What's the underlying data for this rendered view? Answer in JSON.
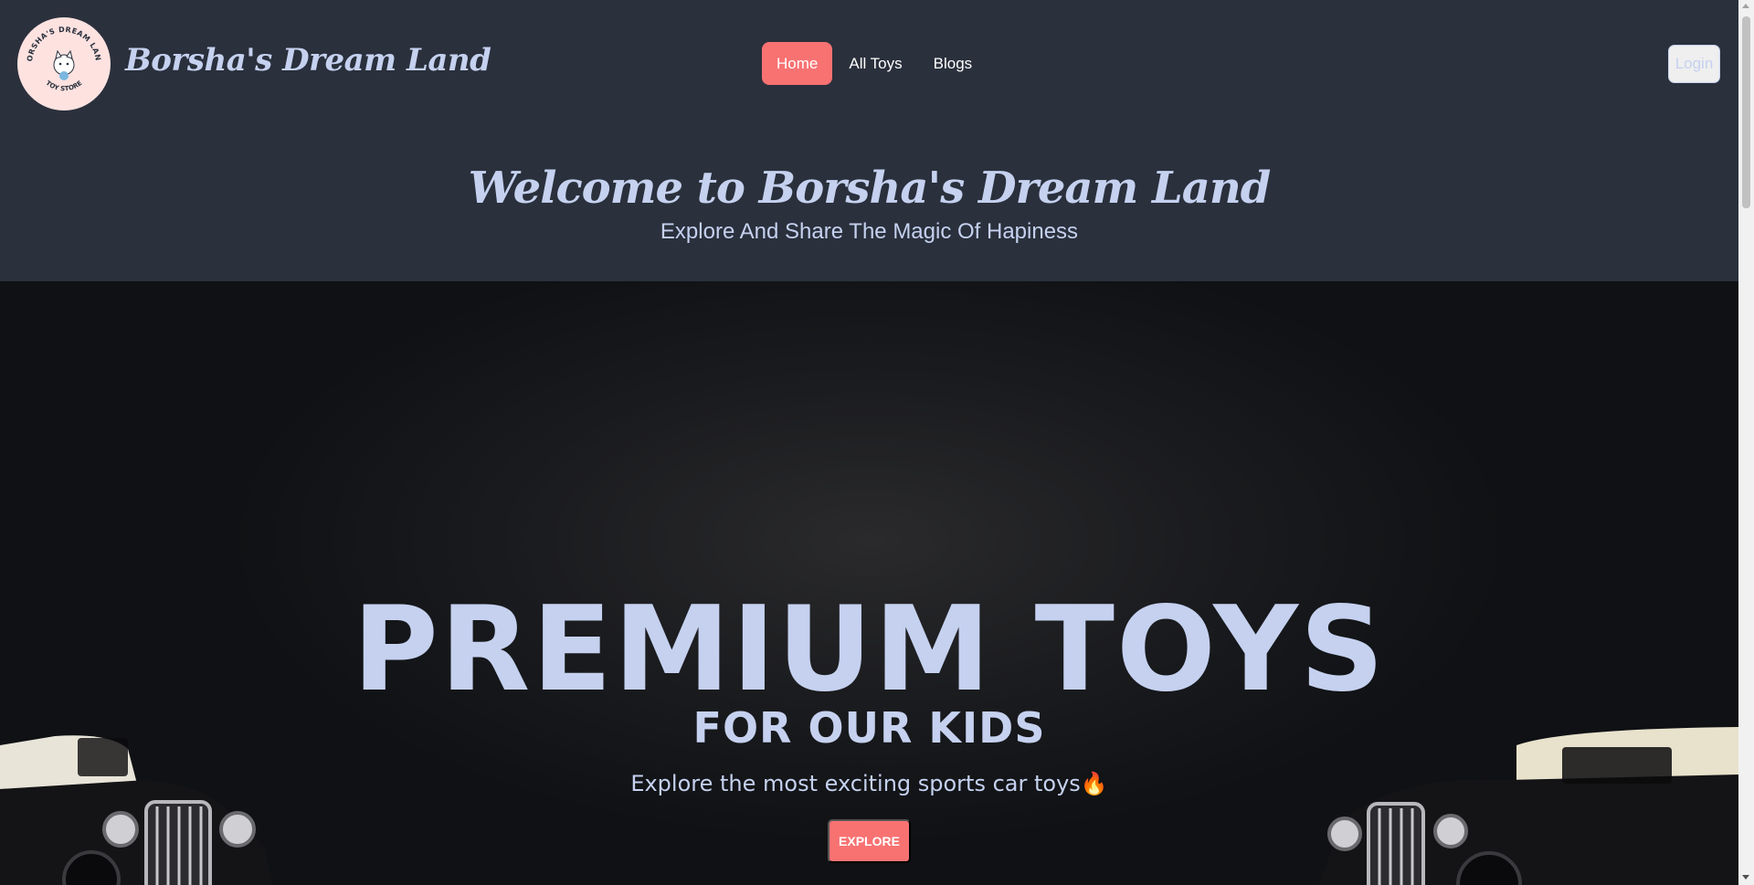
{
  "navbar": {
    "logo_text_top": "BORSHA'S DREAM LAND",
    "logo_text_bottom": "TOY STORE",
    "brand": "Borsha's Dream Land",
    "menu": [
      {
        "label": "Home",
        "active": true
      },
      {
        "label": "All Toys",
        "active": false
      },
      {
        "label": "Blogs",
        "active": false
      }
    ],
    "login_label": "Login"
  },
  "welcome": {
    "title": "Welcome to Borsha's Dream Land",
    "subtitle": "Explore And Share The Magic Of Hapiness"
  },
  "hero": {
    "title": "PREMIUM TOYS",
    "subtitle": "FOR OUR KIDS",
    "text": "Explore the most exciting sports car toys🔥",
    "button_label": "EXPLORE"
  },
  "colors": {
    "background": "#2a303c",
    "accent": "#f87272",
    "text": "#c5d1ef"
  }
}
